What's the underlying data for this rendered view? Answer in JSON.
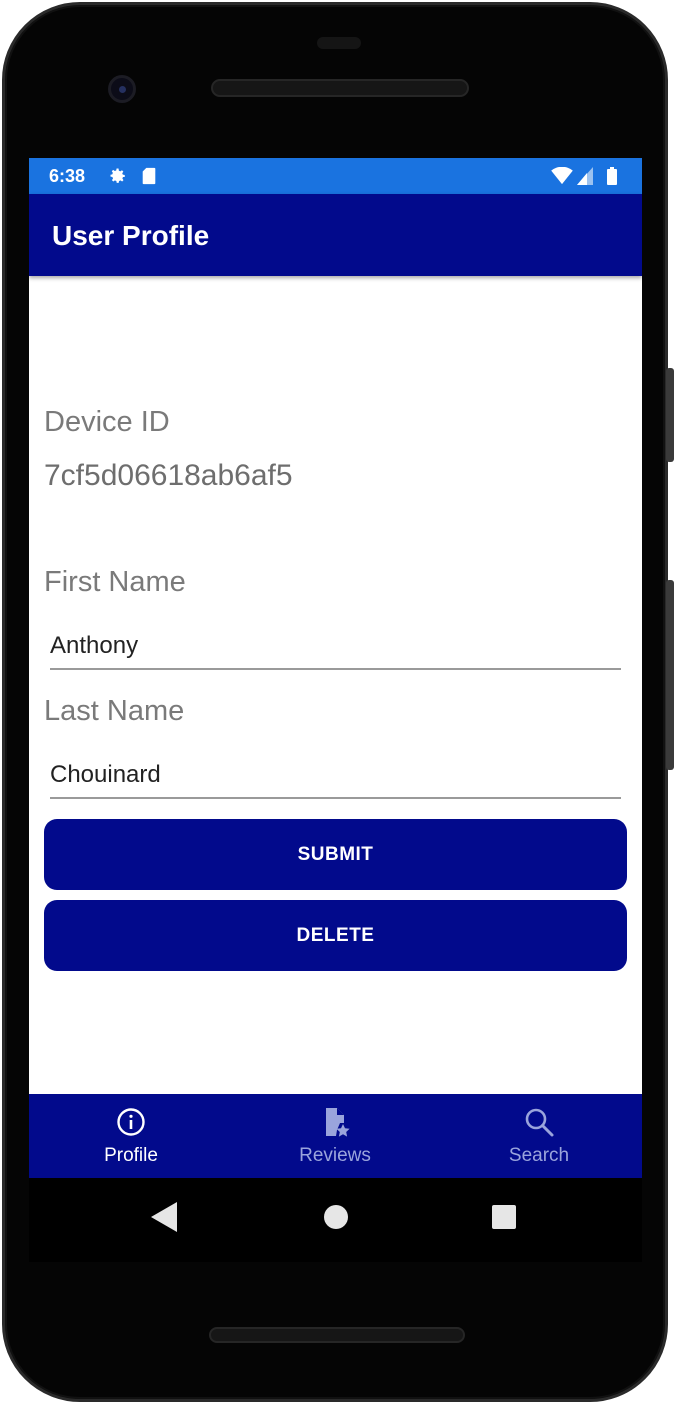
{
  "status_bar": {
    "time": "6:38",
    "icons": [
      "gear-icon",
      "sd-card-icon",
      "wifi-icon",
      "signal-icon",
      "battery-icon"
    ]
  },
  "app_bar": {
    "title": "User Profile"
  },
  "profile": {
    "device_id_label": "Device ID",
    "device_id_value": "7cf5d06618ab6af5",
    "first_name_label": "First Name",
    "first_name_value": "Anthony",
    "last_name_label": "Last Name",
    "last_name_value": "Chouinard",
    "submit_label": "SUBMIT",
    "delete_label": "DELETE"
  },
  "bottom_nav": {
    "items": [
      {
        "label": "Profile",
        "icon": "info-circle-icon",
        "selected": true
      },
      {
        "label": "Reviews",
        "icon": "review-document-icon",
        "selected": false
      },
      {
        "label": "Search",
        "icon": "search-icon",
        "selected": false
      }
    ]
  },
  "system_nav": {
    "icons": [
      "back-icon",
      "home-icon",
      "recents-icon"
    ]
  },
  "colors": {
    "status_bar": "#1a73e0",
    "primary": "#020a8c",
    "nav_inactive": "#9aa4dc",
    "label_text": "#7a7a7a"
  }
}
